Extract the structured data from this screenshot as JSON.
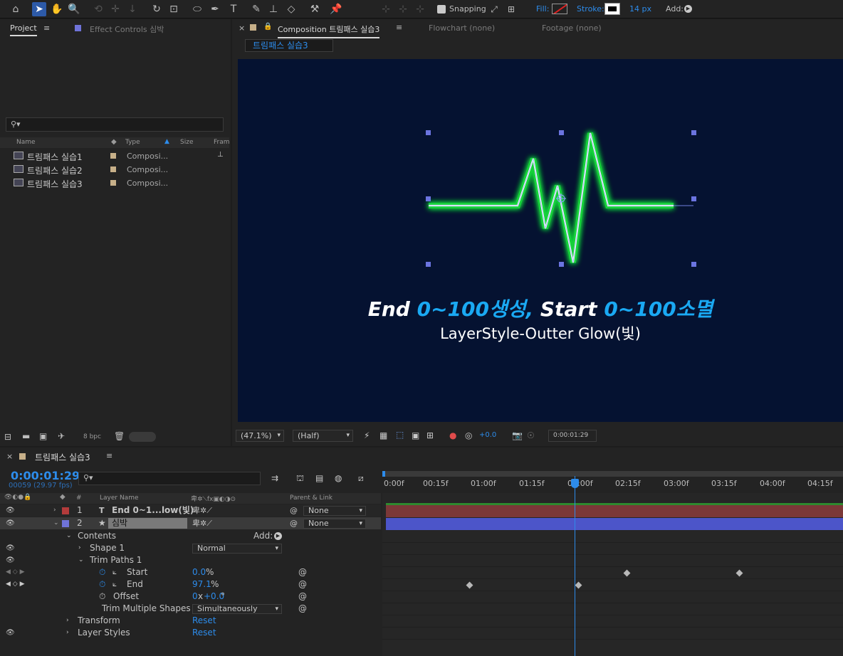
{
  "toolbar": {
    "snapping_label": "Snapping",
    "fill_label": "Fill:",
    "stroke_label": "Stroke:",
    "stroke_width": "14 px",
    "add_label": "Add:"
  },
  "project_panel": {
    "tab_project": "Project",
    "tab_effect_controls": "Effect Controls 심박",
    "columns": {
      "name": "Name",
      "type": "Type",
      "size": "Size",
      "frame": "Fram"
    },
    "items": [
      {
        "name": "트림패스 실습1",
        "type": "Composi..."
      },
      {
        "name": "트림패스 실습2",
        "type": "Composi..."
      },
      {
        "name": "트림패스 실습3",
        "type": "Composi..."
      }
    ],
    "bpc": "8 bpc"
  },
  "comp_panel": {
    "tab_label": "Composition 트림패스 실습3",
    "tab_flowchart": "Flowchart (none)",
    "tab_footage": "Footage (none)",
    "breadcrumb": "트림패스 실습3",
    "title_part1": "End ",
    "title_part2": "0~100생성,",
    "title_part3": " Start ",
    "title_part4": " 0~100소멸",
    "subtitle": "LayerStyle-Outter Glow(빛)",
    "zoom": "(47.1%)",
    "resolution": "(Half)",
    "exposure": "+0.0",
    "timecode": "0:00:01:29"
  },
  "timeline": {
    "tab_label": "트림패스 실습3",
    "current_time": "0:00:01:29",
    "frame_info": "00059 (29.97 fps)",
    "col_layer_name": "Layer Name",
    "col_parent": "Parent & Link",
    "ruler": [
      "0:00f",
      "00:15f",
      "01:00f",
      "01:15f",
      "02:00f",
      "02:15f",
      "03:00f",
      "03:15f",
      "04:00f",
      "04:15f"
    ],
    "layers": [
      {
        "num": "1",
        "name": "End 0~1...low(빛)",
        "parent": "None",
        "color": "#b33b3b"
      },
      {
        "num": "2",
        "name": "심박",
        "parent": "None",
        "color": "#6f73d9"
      }
    ],
    "props": {
      "contents": "Contents",
      "add": "Add:",
      "shape1": "Shape 1",
      "shape1_mode": "Normal",
      "trim_paths": "Trim Paths 1",
      "start_label": "Start",
      "start_value": "0.0",
      "end_label": "End",
      "end_value": "97.1",
      "offset_label": "Offset",
      "offset_value_x": "0",
      "offset_value": "+0.0",
      "trim_multi_label": "Trim Multiple Shapes",
      "trim_multi_value": "Simultaneously",
      "transform": "Transform",
      "transform_reset": "Reset",
      "layer_styles": "Layer Styles",
      "layer_styles_reset": "Reset"
    }
  }
}
